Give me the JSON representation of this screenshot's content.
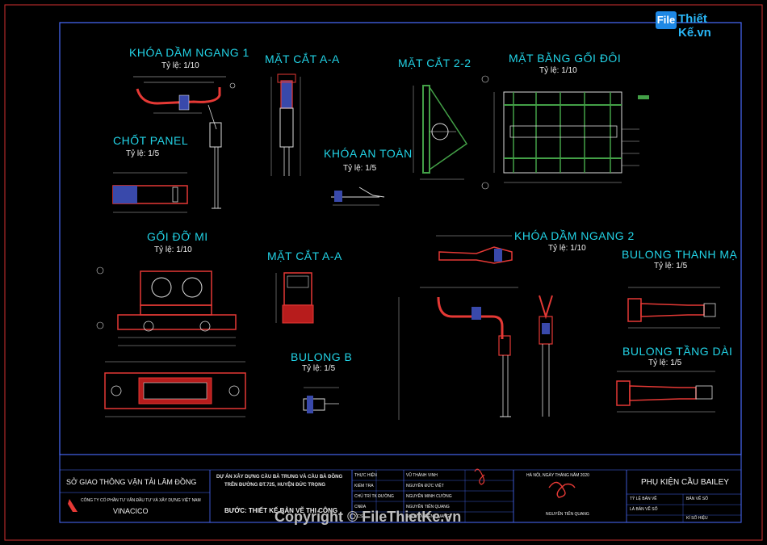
{
  "logo": {
    "mark": "File",
    "text": "Thiết Kế.vn"
  },
  "drawing_titles": [
    {
      "id": "khoa-dam-ngang-1",
      "title": "KHÓA DẦM NGANG 1",
      "scale": "Tỷ lệ: 1/10"
    },
    {
      "id": "mat-cat-aa-1",
      "title": "MẶT CẮT A-A",
      "scale": ""
    },
    {
      "id": "mat-cat-22",
      "title": "MẶT CẮT 2-2",
      "scale": ""
    },
    {
      "id": "mat-bang-goi-doi",
      "title": "MẶT BẰNG GỐI ĐÔI",
      "scale": "Tỷ lệ: 1/10"
    },
    {
      "id": "chot-panel",
      "title": "CHỐT PANEL",
      "scale": "Tỷ lệ: 1/5"
    },
    {
      "id": "khoa-an-toan",
      "title": "KHÓA AN TOÀN",
      "scale": "Tỷ lệ: 1/5"
    },
    {
      "id": "goi-do-mi",
      "title": "GỐI ĐỠ MI",
      "scale": "Tỷ lệ: 1/10"
    },
    {
      "id": "mat-cat-aa-2",
      "title": "MẶT CẮT A-A",
      "scale": ""
    },
    {
      "id": "khoa-dam-ngang-2",
      "title": "KHÓA DẦM NGANG 2",
      "scale": "Tỷ lệ: 1/10"
    },
    {
      "id": "bulong-thanh-ma",
      "title": "BULONG THANH MẠ",
      "scale": "Tỷ lệ: 1/5"
    },
    {
      "id": "bulong-b",
      "title": "BULONG B",
      "scale": "Tỷ lệ: 1/5"
    },
    {
      "id": "bulong-tang-dai",
      "title": "BULONG TẦNG DÀI",
      "scale": "Tỷ lệ: 1/5"
    }
  ],
  "title_block": {
    "agency": "SỞ GIAO THÔNG VẬN TẢI LÂM ĐỒNG",
    "company": "CÔNG TY CỔ PHẦN TƯ VẤN ĐẦU TƯ VÀ XÂY DỰNG VIỆT NAM",
    "company_brand": "VINACICO",
    "project_line1": "DỰ ÁN XÂY DỰNG CẦU BÀ TRUNG VÀ CẦU BÀ ĐỒNG",
    "project_line2": "TRÊN ĐƯỜNG ĐT.725, HUYỆN ĐỨC TRỌNG",
    "step": "BƯỚC: THIẾT KẾ BẢN VẼ THI CÔNG",
    "roles": [
      {
        "role": "THỰC HIỆN",
        "name": "VŨ THÀNH VINH"
      },
      {
        "role": "KIỂM TRA",
        "name": "NGUYỄN ĐỨC VIỆT"
      },
      {
        "role": "CHỦ TRÌ TK ĐƯỜNG",
        "name": "NGUYỄN MINH CƯỜNG"
      },
      {
        "role": "CNĐA",
        "name": "NGUYỄN TIẾN QUANG"
      },
      {
        "role": "KCS",
        "name": "NGUYỄN TIẾN QUANG"
      }
    ],
    "date_line": "HÀ NỘI, NGÀY    THÁNG    NĂM 2020",
    "signer": "NGUYỄN TIẾN QUANG",
    "sheet_title": "PHỤ KIỆN CẦU BAILEY",
    "sheet_label1": "TỶ LỆ BẢN VẼ",
    "sheet_label2": "BẢN VẼ SỐ",
    "sheet_label3": "LÀ BẢN VẼ SỐ",
    "sheet_label4": "KÍ SỐ HIỆU"
  },
  "copyright": "Copyright © FileThietKe.vn"
}
